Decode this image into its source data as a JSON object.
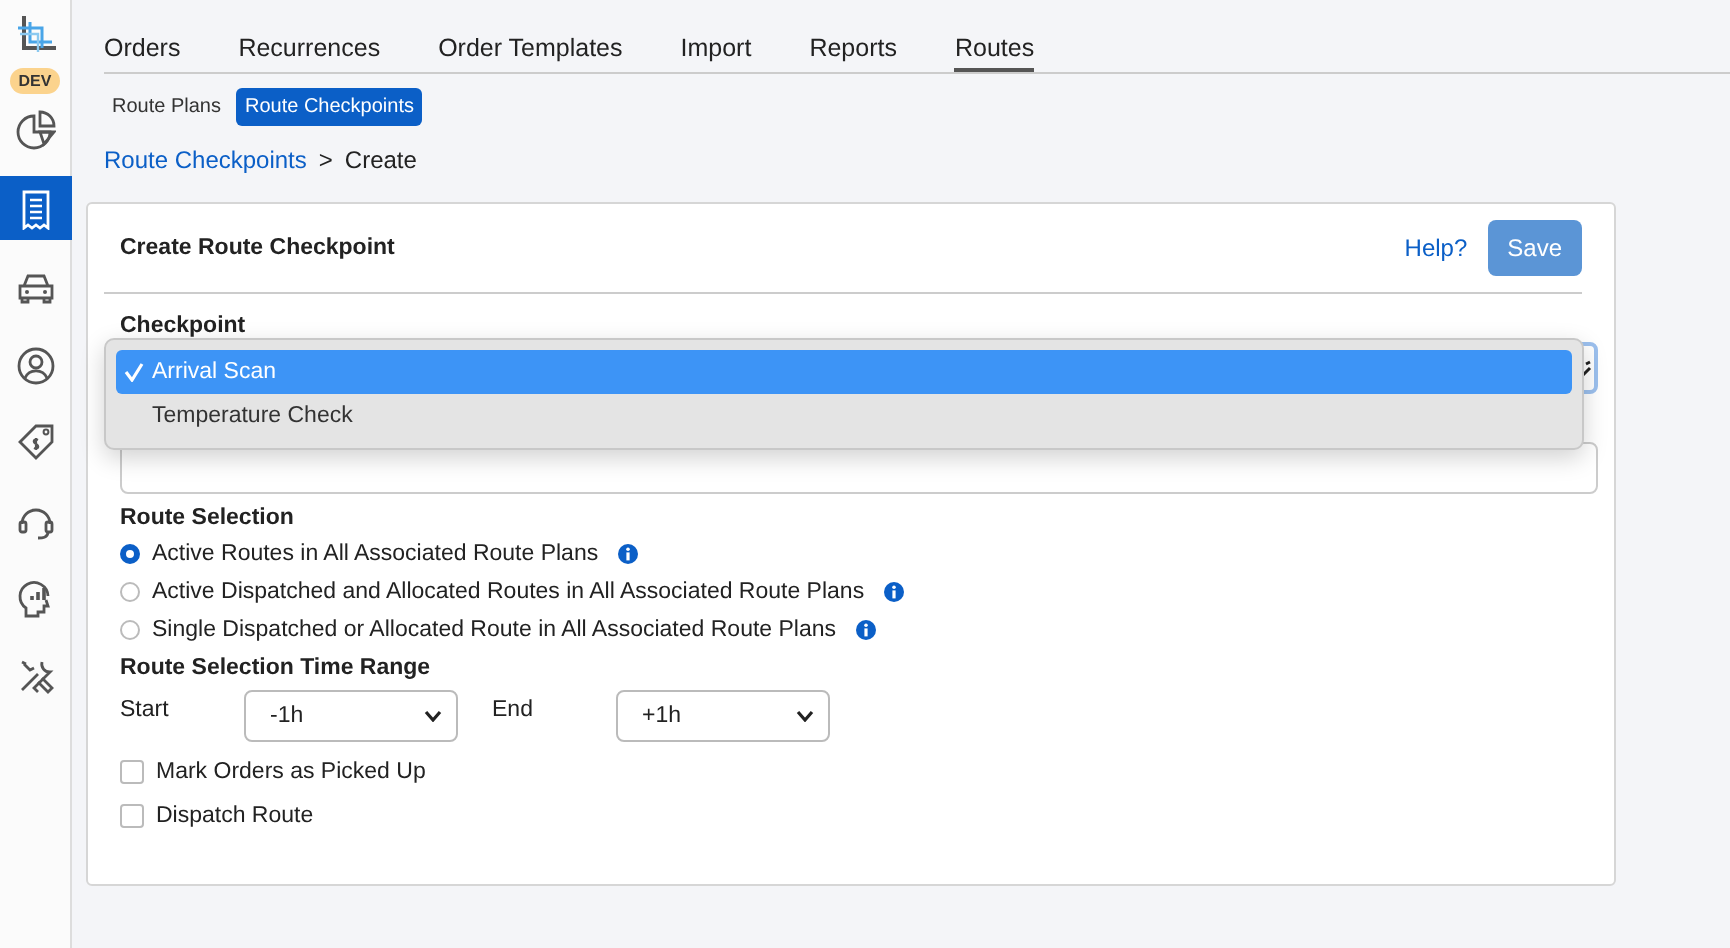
{
  "nav_rail": {
    "badge": "DEV",
    "items": [
      {
        "selected": false
      },
      {
        "selected": true
      },
      {
        "selected": false
      },
      {
        "selected": false
      },
      {
        "selected": false
      },
      {
        "selected": false
      },
      {
        "selected": false
      },
      {
        "selected": false
      }
    ]
  },
  "tabs": [
    {
      "label": "Orders",
      "selected": false
    },
    {
      "label": "Recurrences",
      "selected": false
    },
    {
      "label": "Order Templates",
      "selected": false
    },
    {
      "label": "Import",
      "selected": false
    },
    {
      "label": "Reports",
      "selected": false
    },
    {
      "label": "Routes",
      "selected": true
    }
  ],
  "subtabs": [
    {
      "label": "Route Plans",
      "selected": false
    },
    {
      "label": "Route Checkpoints",
      "selected": true
    }
  ],
  "breadcrumb": {
    "link": "Route Checkpoints",
    "separator": ">",
    "current": "Create"
  },
  "card": {
    "title": "Create Route Checkpoint",
    "help": "Help?",
    "save": {
      "label": "Save",
      "disabled": true
    },
    "checkpoint": {
      "label": "Checkpoint",
      "options": [
        {
          "label": "Arrival Scan",
          "selected": true
        },
        {
          "label": "Temperature Check",
          "selected": false
        }
      ]
    },
    "route_selection": {
      "label": "Route Selection",
      "options": [
        {
          "label": "Active Routes in All Associated Route Plans",
          "selected": true
        },
        {
          "label": "Active Dispatched and Allocated Routes in All Associated Route Plans",
          "selected": false
        },
        {
          "label": "Single Dispatched or Allocated Route in All Associated Route Plans",
          "selected": false
        }
      ]
    },
    "time_range": {
      "label": "Route Selection Time Range",
      "start": {
        "label": "Start",
        "value": "-1h"
      },
      "end": {
        "label": "End",
        "value": "+1h"
      }
    },
    "checkboxes": [
      {
        "label": "Mark Orders as Picked Up",
        "checked": false
      },
      {
        "label": "Dispatch Route",
        "checked": false
      }
    ]
  }
}
